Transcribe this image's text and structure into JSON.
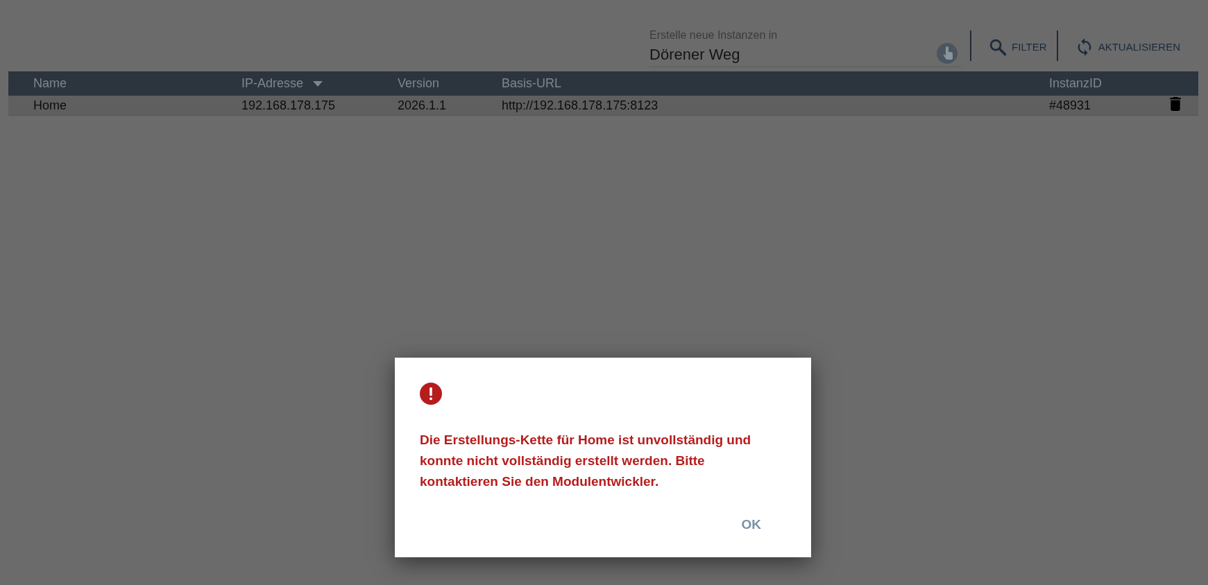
{
  "toolbar": {
    "instance_field": {
      "label": "Erstelle neue Instanzen in",
      "value": "Dörener Weg"
    },
    "buttons": [
      {
        "kind": "filter",
        "label": "FILTER"
      },
      {
        "kind": "refresh",
        "label": "AKTUALISIEREN"
      }
    ]
  },
  "table": {
    "columns": [
      {
        "label": "Name",
        "sorted": false
      },
      {
        "label": "IP-Adresse",
        "sorted": true
      },
      {
        "label": "Version",
        "sorted": false
      },
      {
        "label": "Basis-URL",
        "sorted": false
      },
      {
        "label": "InstanzID",
        "sorted": false
      }
    ],
    "rows": [
      {
        "cells": [
          "Home",
          "192.168.178.175",
          "2026.1.1",
          "http://192.168.178.175:8123",
          "#48931"
        ]
      }
    ]
  },
  "dialog": {
    "message": "Die Erstellungs-Kette für Home ist unvollständig und konnte nicht vollständig erstellt werden. Bitte kontaktieren Sie den Modulentwickler.",
    "button": "OK"
  }
}
